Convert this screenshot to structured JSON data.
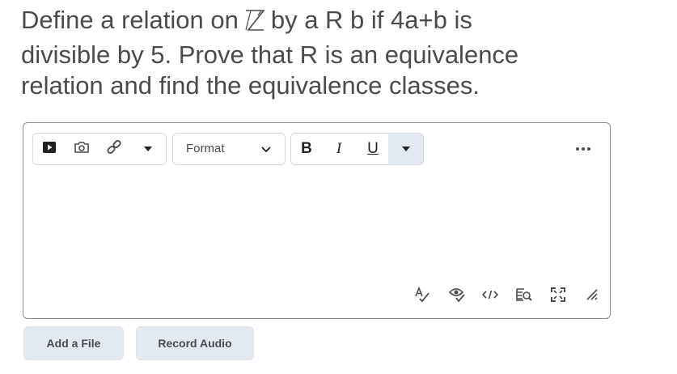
{
  "question": {
    "line1_before": "Define a relation on",
    "set_symbol": "ℤ",
    "line1_after": "by a R b if   4a+b is",
    "line2": "divisible by 5.  Prove that  R is an equivalence",
    "line3": "relation and  find the equivalence classes."
  },
  "toolbar": {
    "format_label": "Format",
    "bold_label": "B",
    "italic_label": "I",
    "underline_label": "U"
  },
  "icons": {
    "video": "video-icon",
    "camera": "camera-icon",
    "link": "link-icon",
    "insert_dropdown": "caret-down-icon",
    "more": "more-horizontal-icon",
    "spellcheck": "spellcheck-icon",
    "accessibility": "accessibility-check-icon",
    "source_code": "source-code-icon",
    "preview": "preview-icon",
    "fullscreen": "fullscreen-icon",
    "resize": "resize-handle-icon"
  },
  "buttons": {
    "add_file": "Add a File",
    "record_audio": "Record Audio"
  },
  "colors": {
    "text": "#494c4e",
    "button_bg": "#e3e9f1",
    "border": "#8a8c8e"
  }
}
